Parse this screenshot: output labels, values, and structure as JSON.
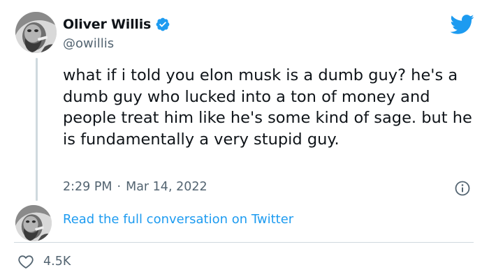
{
  "author": {
    "display_name": "Oliver Willis",
    "handle": "@owillis",
    "verified": true
  },
  "tweet": {
    "text": "what if i told you elon musk is a dumb guy? he's a dumb guy who lucked into a ton of money and people treat him like he's some kind of sage. but he is fundamentally a very stupid guy.",
    "time": "2:29 PM",
    "separator": "·",
    "date": "Mar 14, 2022"
  },
  "links": {
    "read_full": "Read the full conversation on Twitter"
  },
  "stats": {
    "likes": "4.5K"
  },
  "icons": {
    "brand": "twitter-bird-icon",
    "verified": "verified-badge-icon",
    "info": "info-icon",
    "like": "heart-icon"
  },
  "colors": {
    "brand_blue": "#1d9bf0",
    "text_primary": "#0f1419",
    "text_secondary": "#536471",
    "border": "#cfd9de"
  }
}
